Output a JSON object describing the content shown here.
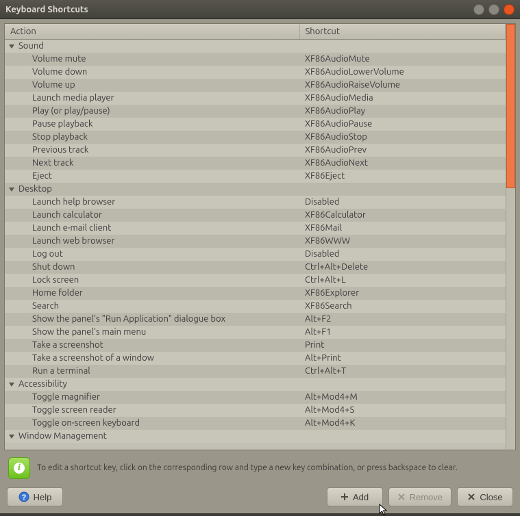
{
  "window": {
    "title": "Keyboard Shortcuts"
  },
  "columns": {
    "action": "Action",
    "shortcut": "Shortcut"
  },
  "groups": [
    {
      "name": "Sound",
      "items": [
        {
          "action": "Volume mute",
          "shortcut": "XF86AudioMute"
        },
        {
          "action": "Volume down",
          "shortcut": "XF86AudioLowerVolume"
        },
        {
          "action": "Volume up",
          "shortcut": "XF86AudioRaiseVolume"
        },
        {
          "action": "Launch media player",
          "shortcut": "XF86AudioMedia"
        },
        {
          "action": "Play (or play/pause)",
          "shortcut": "XF86AudioPlay"
        },
        {
          "action": "Pause playback",
          "shortcut": "XF86AudioPause"
        },
        {
          "action": "Stop playback",
          "shortcut": "XF86AudioStop"
        },
        {
          "action": "Previous track",
          "shortcut": "XF86AudioPrev"
        },
        {
          "action": "Next track",
          "shortcut": "XF86AudioNext"
        },
        {
          "action": "Eject",
          "shortcut": "XF86Eject"
        }
      ]
    },
    {
      "name": "Desktop",
      "items": [
        {
          "action": "Launch help browser",
          "shortcut": "Disabled"
        },
        {
          "action": "Launch calculator",
          "shortcut": "XF86Calculator"
        },
        {
          "action": "Launch e-mail client",
          "shortcut": "XF86Mail"
        },
        {
          "action": "Launch web browser",
          "shortcut": "XF86WWW"
        },
        {
          "action": "Log out",
          "shortcut": "Disabled"
        },
        {
          "action": "Shut down",
          "shortcut": "Ctrl+Alt+Delete"
        },
        {
          "action": "Lock screen",
          "shortcut": "Ctrl+Alt+L"
        },
        {
          "action": "Home folder",
          "shortcut": "XF86Explorer"
        },
        {
          "action": "Search",
          "shortcut": "XF86Search"
        },
        {
          "action": "Show the panel's \"Run Application\" dialogue box",
          "shortcut": "Alt+F2"
        },
        {
          "action": "Show the panel's main menu",
          "shortcut": "Alt+F1"
        },
        {
          "action": "Take a screenshot",
          "shortcut": "Print"
        },
        {
          "action": "Take a screenshot of a window",
          "shortcut": "Alt+Print"
        },
        {
          "action": "Run a terminal",
          "shortcut": "Ctrl+Alt+T"
        }
      ]
    },
    {
      "name": "Accessibility",
      "items": [
        {
          "action": "Toggle magnifier",
          "shortcut": "Alt+Mod4+M"
        },
        {
          "action": "Toggle screen reader",
          "shortcut": "Alt+Mod4+S"
        },
        {
          "action": "Toggle on-screen keyboard",
          "shortcut": "Alt+Mod4+K"
        }
      ]
    },
    {
      "name": "Window Management",
      "items": []
    }
  ],
  "hint": "To edit a shortcut key, click on the corresponding row and type a new key combination, or press backspace to clear.",
  "buttons": {
    "help": "Help",
    "add": "Add",
    "remove": "Remove",
    "close": "Close"
  }
}
